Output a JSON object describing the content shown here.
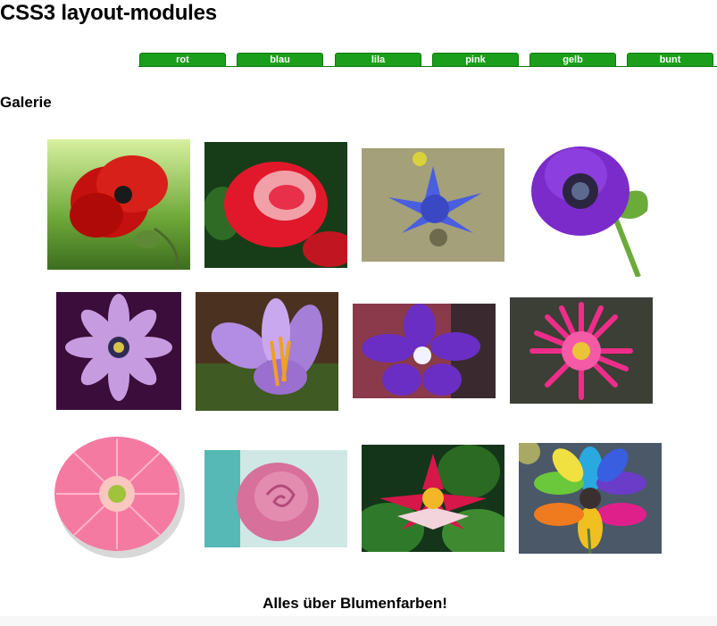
{
  "page": {
    "title": "CSS3 layout-modules"
  },
  "nav": {
    "tabs": [
      "rot",
      "blau",
      "lila",
      "pink",
      "gelb",
      "bunt"
    ]
  },
  "gallery": {
    "heading": "Galerie",
    "photos": [
      "red-poppy",
      "red-rose",
      "blue-cornflower",
      "purple-anemone",
      "lilac-daisy",
      "lilac-crocus",
      "purple-bellflower",
      "pink-dahlia",
      "pink-gerbera",
      "pink-rose",
      "pink-water-lily",
      "rainbow-flower"
    ]
  },
  "footer": {
    "text": "Alles über Blumenfarben!"
  },
  "colors": {
    "tab_green": "#1b9e1b"
  }
}
